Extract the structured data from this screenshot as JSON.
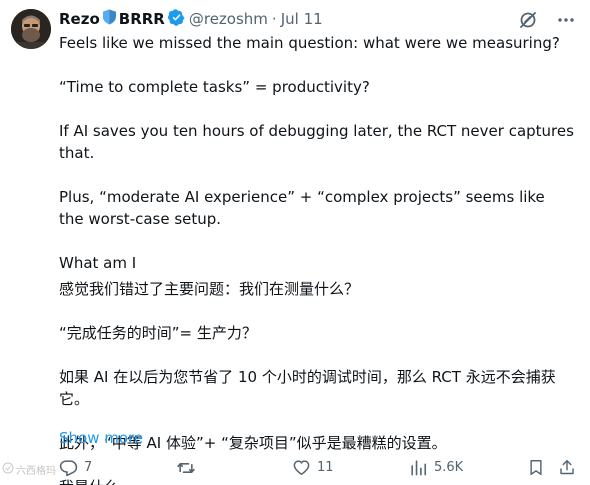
{
  "author": {
    "display_name": "Rezo",
    "name_suffix": "BRRR",
    "handle": "@rezoshm",
    "separator": "·",
    "date": "Jul 11"
  },
  "tweet": {
    "paragraphs": [
      "Feels like we missed the main question: what were we measuring?",
      "“Time to complete tasks” = productivity?",
      "If AI saves you ten hours of debugging later, the RCT never captures that.",
      "Plus, “moderate AI experience” + “complex projects” seems like the worst-case setup.",
      "What am I",
      "感觉我们错过了主要问题：我们在测量什么？",
      "“完成任务的时间”= 生产力？",
      "如果 AI 在以后为您节省了 10 个小时的调试时间，那么 RCT 永远不会捕获它。",
      "此外，“中等 AI 体验”+ “复杂项目”似乎是最糟糕的设置。",
      "我是什么"
    ],
    "show_more": "Show more"
  },
  "actions": {
    "replies": "7",
    "retweets": "",
    "likes": "11",
    "views": "5.6K"
  },
  "watermark": "六西格玛",
  "colors": {
    "text": "#0f1419",
    "muted": "#536471",
    "link": "#1d9bf0",
    "verified": "#1d9bf0"
  },
  "icons": {
    "grok": "grok-icon",
    "more": "more-icon",
    "reply": "reply-icon",
    "retweet": "retweet-icon",
    "like": "like-icon",
    "views": "views-icon",
    "bookmark": "bookmark-icon",
    "share": "share-icon"
  }
}
